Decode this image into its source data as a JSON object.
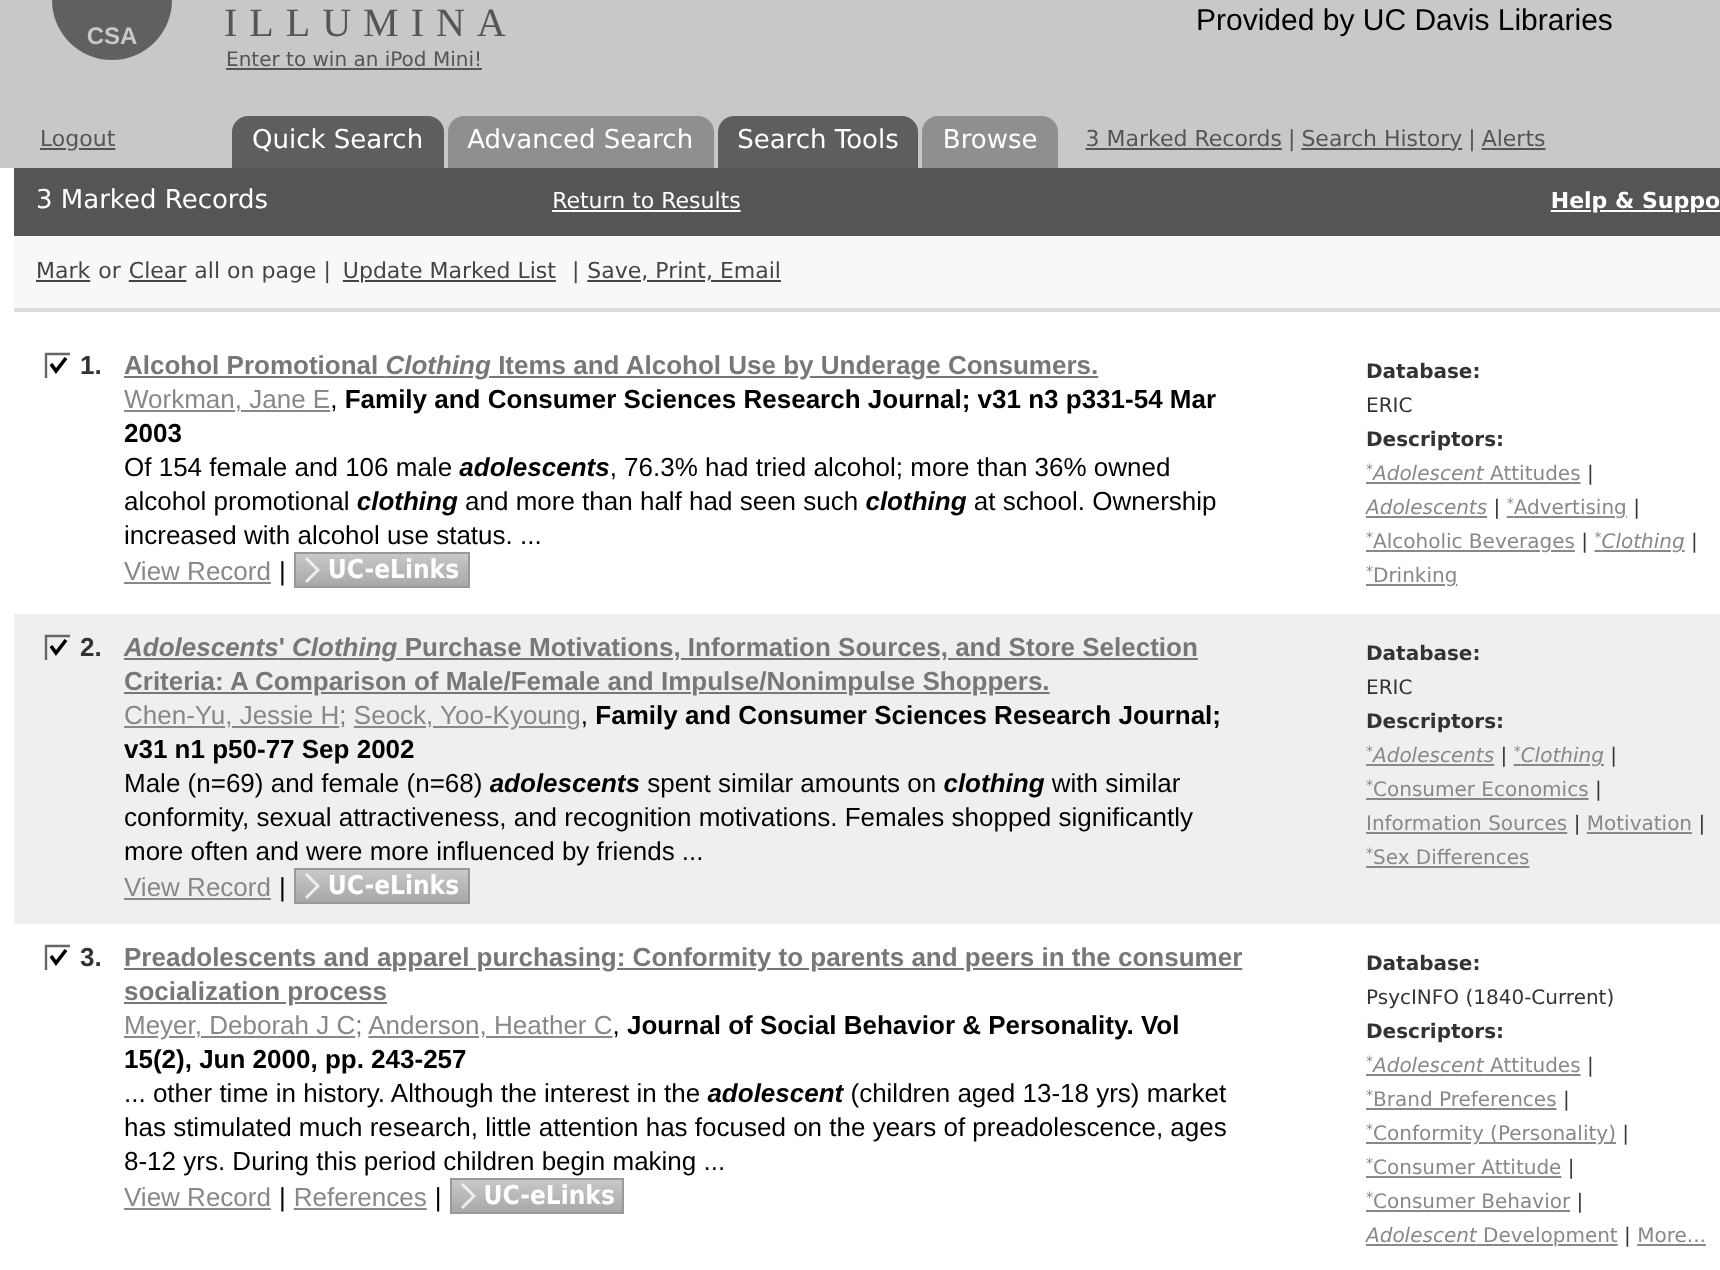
{
  "header": {
    "logo_text": "CSA",
    "brand": "ILLUMINA",
    "promo_link": "Enter to win an iPod Mini!",
    "provider": "Provided by UC Davis Libraries"
  },
  "nav": {
    "logout": "Logout",
    "tabs": [
      {
        "label": "Quick Search",
        "kind": "dark"
      },
      {
        "label": "Advanced Search",
        "kind": "light"
      },
      {
        "label": "Search Tools",
        "kind": "dark"
      },
      {
        "label": "Browse",
        "kind": "light"
      }
    ],
    "links": [
      "3 Marked Records",
      "Search History",
      "Alerts"
    ],
    "separator": "|"
  },
  "bar": {
    "title": "3 Marked Records",
    "return_link": "Return to Results",
    "help_link": "Help & Suppo"
  },
  "toolbar": {
    "mark": "Mark",
    "or": "or",
    "clear": "Clear",
    "suffix": "all on page |",
    "update": "Update Marked List",
    "separator": "|",
    "save": "Save, Print, Email"
  },
  "records": [
    {
      "number": "1.",
      "checked": true,
      "shaded": false,
      "separator": "|",
      "source_separator": ",",
      "title": "Alcohol Promotional *Clothing* Items and Alcohol Use by Underage Consumers.",
      "authors": [
        "Workman, Jane E"
      ],
      "source": "Family and Consumer Sciences Research Journal; v31 n3 p331-54 Mar 2003",
      "abstract": "Of 154 female and 106 male **adolescents**, 76.3% had tried alcohol; more than 36% owned alcohol promotional **clothing** and more than half had seen such **clothing** at school. Ownership increased with alcohol use status. ...",
      "links": [
        "View Record"
      ],
      "elinks": "UC-eLinks",
      "database_label": "Database:",
      "database": "ERIC",
      "descriptors_label": "Descriptors:",
      "descriptors": [
        "$^{*}$*Adolescent* Attitudes",
        "*Adolescents*",
        "$^{*}$Advertising",
        "$^{*}$Alcoholic Beverages",
        "$^{*}$*Clothing*",
        "$^{*}$Drinking"
      ]
    },
    {
      "number": "2.",
      "checked": true,
      "shaded": true,
      "separator": "|",
      "author_separator": ";",
      "source_separator": ",",
      "title": "*Adolescents*' *Clothing* Purchase Motivations, Information Sources, and Store Selection Criteria: A Comparison of Male/Female and Impulse/Nonimpulse Shoppers.",
      "authors": [
        "Chen-Yu, Jessie H",
        "Seock, Yoo-Kyoung"
      ],
      "source": "Family and Consumer Sciences Research Journal; v31 n1 p50-77 Sep 2002",
      "abstract": "Male (n=69) and female (n=68) **adolescents** spent similar amounts on **clothing** with similar conformity, sexual attractiveness, and recognition motivations. Females shopped significantly more often and were more influenced by friends ...",
      "links": [
        "View Record"
      ],
      "elinks": "UC-eLinks",
      "database_label": "Database:",
      "database": "ERIC",
      "descriptors_label": "Descriptors:",
      "descriptors": [
        "$^{*}$*Adolescents*",
        "$^{*}$*Clothing*",
        "$^{*}$Consumer Economics",
        "Information Sources",
        "Motivation",
        "$^{*}$Sex Differences"
      ]
    },
    {
      "number": "3.",
      "checked": true,
      "shaded": false,
      "separator": "|",
      "author_separator": ";",
      "source_separator": ",",
      "title": "Preadolescents and apparel purchasing: Conformity to parents and peers in the consumer socialization process",
      "authors": [
        "Meyer, Deborah J C",
        "Anderson, Heather C"
      ],
      "source": "Journal of Social Behavior & Personality. Vol 15(2), Jun 2000, pp. 243-257",
      "abstract": "... other time in history. Although the interest in the **adolescent** (children aged 13-18 yrs) market has stimulated much research, little attention has focused on the years of preadolescence, ages 8-12 yrs. During this period children begin making ...",
      "links": [
        "View Record",
        "References"
      ],
      "elinks": "UC-eLinks",
      "database_label": "Database:",
      "database": "PsycINFO (1840-Current)",
      "descriptors_label": "Descriptors:",
      "descriptors": [
        "$^{*}$*Adolescent* Attitudes",
        "$^{*}$Brand Preferences",
        "$^{*}$Conformity (Personality)",
        "$^{*}$Consumer Attitude",
        "$^{*}$Consumer Behavior",
        "*Adolescent* Development",
        "More..."
      ]
    }
  ]
}
